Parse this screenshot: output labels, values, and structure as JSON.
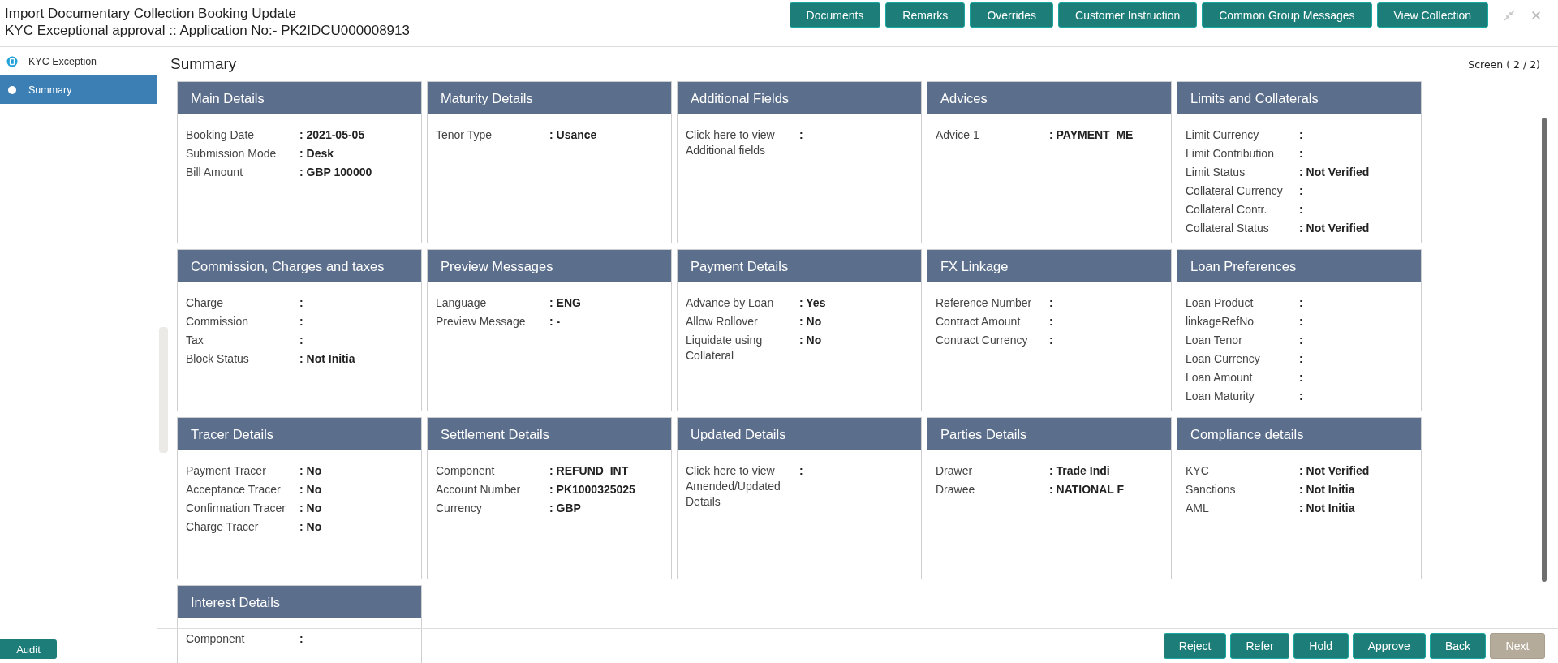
{
  "header": {
    "title": "Import Documentary Collection Booking Update",
    "subtitle": "KYC Exceptional approval ::  Application No:- PK2IDCU000008913",
    "buttons": [
      "Documents",
      "Remarks",
      "Overrides",
      "Customer Instruction",
      "Common Group Messages",
      "View Collection"
    ]
  },
  "sidebar": {
    "steps": [
      {
        "label": "KYC Exception",
        "selected": false
      },
      {
        "label": "Summary",
        "selected": true
      }
    ],
    "audit_button": "Audit"
  },
  "summary": {
    "title": "Summary",
    "screen_indicator": "Screen ( 2 / 2)",
    "cards": [
      {
        "title": "Main Details",
        "fields": [
          {
            "label": "Booking Date",
            "value": ": 2021-05-05"
          },
          {
            "label": "Submission Mode",
            "value": ": Desk"
          },
          {
            "label": "Bill Amount",
            "value": ": GBP 100000"
          }
        ]
      },
      {
        "title": "Maturity Details",
        "fields": [
          {
            "label": "Tenor Type",
            "value": ": Usance"
          }
        ]
      },
      {
        "title": "Additional Fields",
        "fields": [
          {
            "label": "Click here to view Additional fields",
            "value": ":"
          }
        ]
      },
      {
        "title": "Advices",
        "fields": [
          {
            "label": "Advice 1",
            "value": ": PAYMENT_ME"
          }
        ]
      },
      {
        "title": "Limits and Collaterals",
        "fields": [
          {
            "label": "Limit Currency",
            "value": ":"
          },
          {
            "label": "Limit Contribution",
            "value": ":"
          },
          {
            "label": "Limit Status",
            "value": ": Not Verified"
          },
          {
            "label": "Collateral Currency",
            "value": ":"
          },
          {
            "label": "Collateral Contr.",
            "value": ":"
          },
          {
            "label": "Collateral Status",
            "value": ": Not Verified"
          }
        ]
      },
      {
        "title": "Commission, Charges and taxes",
        "fields": [
          {
            "label": "Charge",
            "value": ":"
          },
          {
            "label": "Commission",
            "value": ":"
          },
          {
            "label": "Tax",
            "value": ":"
          },
          {
            "label": "Block Status",
            "value": ": Not Initia"
          }
        ]
      },
      {
        "title": "Preview Messages",
        "fields": [
          {
            "label": "Language",
            "value": ": ENG"
          },
          {
            "label": "Preview Message",
            "value": ": -"
          }
        ]
      },
      {
        "title": "Payment Details",
        "fields": [
          {
            "label": "Advance by Loan",
            "value": ": Yes"
          },
          {
            "label": "Allow Rollover",
            "value": ": No"
          },
          {
            "label": "Liquidate using Collateral",
            "value": ": No"
          }
        ]
      },
      {
        "title": "FX Linkage",
        "fields": [
          {
            "label": "Reference Number",
            "value": ":"
          },
          {
            "label": "Contract Amount",
            "value": ":"
          },
          {
            "label": "Contract Currency",
            "value": ":"
          }
        ]
      },
      {
        "title": "Loan Preferences",
        "fields": [
          {
            "label": "Loan Product",
            "value": ":"
          },
          {
            "label": "linkageRefNo",
            "value": ":"
          },
          {
            "label": "Loan Tenor",
            "value": ":"
          },
          {
            "label": "Loan Currency",
            "value": ":"
          },
          {
            "label": "Loan Amount",
            "value": ":"
          },
          {
            "label": "Loan Maturity",
            "value": ":"
          }
        ]
      },
      {
        "title": "Tracer Details",
        "fields": [
          {
            "label": "Payment Tracer",
            "value": ": No"
          },
          {
            "label": "Acceptance Tracer",
            "value": ": No"
          },
          {
            "label": "Confirmation Tracer",
            "value": ": No"
          },
          {
            "label": "Charge Tracer",
            "value": ": No"
          }
        ]
      },
      {
        "title": "Settlement Details",
        "fields": [
          {
            "label": "Component",
            "value": ": REFUND_INT"
          },
          {
            "label": "Account Number",
            "value": ": PK1000325025"
          },
          {
            "label": "Currency",
            "value": ": GBP"
          }
        ]
      },
      {
        "title": "Updated Details",
        "fields": [
          {
            "label": "Click here to view Amended/Updated Details",
            "value": ":"
          }
        ]
      },
      {
        "title": "Parties Details",
        "fields": [
          {
            "label": "Drawer",
            "value": ": Trade Indi"
          },
          {
            "label": "Drawee",
            "value": ": NATIONAL F"
          }
        ]
      },
      {
        "title": "Compliance details",
        "fields": [
          {
            "label": "KYC",
            "value": ": Not Verified"
          },
          {
            "label": "Sanctions",
            "value": ": Not Initia"
          },
          {
            "label": "AML",
            "value": ": Not Initia"
          }
        ]
      },
      {
        "title": "Interest Details",
        "fields": [
          {
            "label": "Component",
            "value": ":"
          }
        ]
      }
    ]
  },
  "footer_buttons": [
    {
      "label": "Reject",
      "disabled": false
    },
    {
      "label": "Refer",
      "disabled": false
    },
    {
      "label": "Hold",
      "disabled": false
    },
    {
      "label": "Approve",
      "disabled": false
    },
    {
      "label": "Back",
      "disabled": false
    },
    {
      "label": "Next",
      "disabled": true
    }
  ]
}
